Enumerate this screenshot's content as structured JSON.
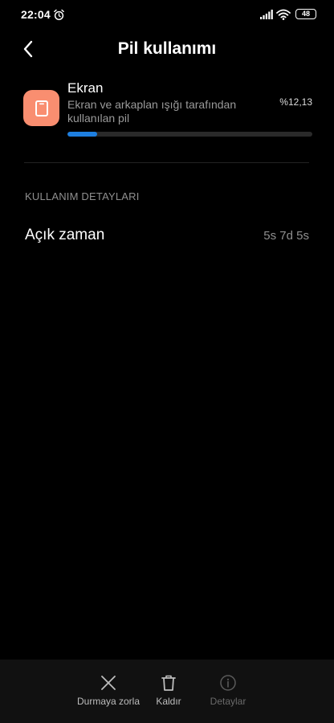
{
  "status_bar": {
    "time": "22:04",
    "battery_level": "48",
    "icons": [
      "alarm-icon",
      "signal-icon",
      "wifi-icon",
      "battery-icon"
    ]
  },
  "header": {
    "title": "Pil kullanımı",
    "back_icon": "chevron-left-icon"
  },
  "usage": {
    "app_name": "Ekran",
    "description": "Ekran ve arkaplan ışığı tarafından kullanılan pil",
    "percent": "%12,13",
    "progress_fraction": 0.1213,
    "icon": "tablet-icon",
    "icon_color": "#f98e70",
    "progress_color": "#1e7fe0"
  },
  "details": {
    "section_title": "KULLANIM DETAYLARI",
    "rows": [
      {
        "label": "Açık zaman",
        "value": "5s 7d 5s"
      }
    ]
  },
  "bottom_actions": [
    {
      "label": "Durmaya zorla",
      "icon": "close-icon",
      "enabled": true
    },
    {
      "label": "Kaldır",
      "icon": "trash-icon",
      "enabled": true
    },
    {
      "label": "Detaylar",
      "icon": "info-icon",
      "enabled": false
    }
  ]
}
